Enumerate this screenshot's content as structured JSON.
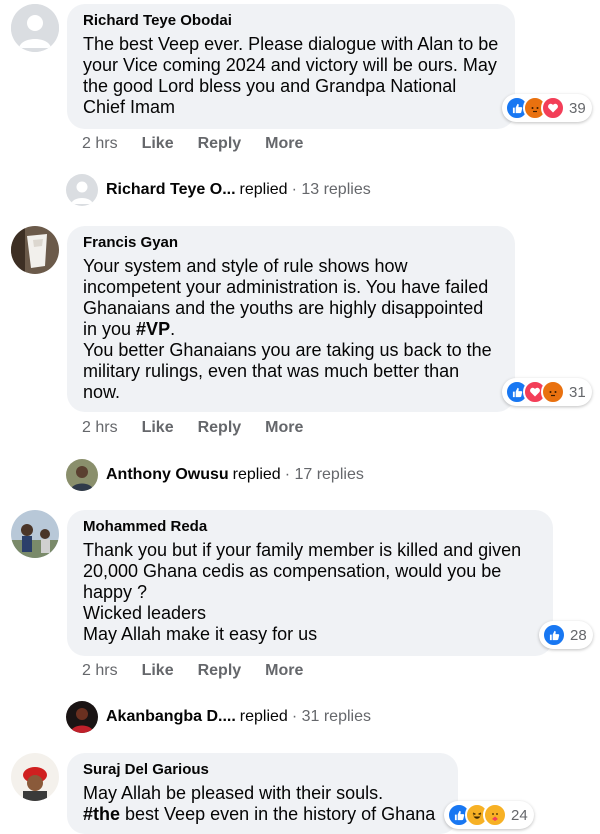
{
  "comments": [
    {
      "author": "Richard Teye Obodai",
      "text": "The best Veep ever. Please dialogue with Alan to be your Vice coming 2024 and victory will be ours. May the good Lord bless you and Grandpa National Chief Imam",
      "reactions": [
        "like-icon",
        "angry-icon",
        "love-icon"
      ],
      "reaction_count": "39",
      "time": "2 hrs",
      "like": "Like",
      "reply": "Reply",
      "more": "More",
      "replies": {
        "name": "Richard Teye O...",
        "verb": "replied",
        "count": "· 13 replies"
      }
    },
    {
      "author": "Francis Gyan",
      "text_before": "Your system and style of rule shows how incompetent your administration is. You have failed Ghanaians and the youths are highly disappointed in you ",
      "hashtag": "#VP",
      "text_after": ".\nYou better Ghanaians you are taking us back to the military rulings, even that was much better than now.",
      "reactions": [
        "like-icon",
        "love-icon",
        "angry-icon"
      ],
      "reaction_count": "31",
      "time": "2 hrs",
      "like": "Like",
      "reply": "Reply",
      "more": "More",
      "replies": {
        "name": "Anthony Owusu",
        "verb": "replied",
        "count": "· 17 replies"
      }
    },
    {
      "author": "Mohammed Reda",
      "text": "Thank you but if your family member is killed and given 20,000 Ghana cedis as compensation, would you be happy ?\nWicked leaders\nMay Allah make it easy for us",
      "reactions": [
        "like-icon"
      ],
      "reaction_count": "28",
      "time": "2 hrs",
      "like": "Like",
      "reply": "Reply",
      "more": "More",
      "replies": {
        "name": "Akanbangba D....",
        "verb": "replied",
        "count": "· 31 replies"
      }
    },
    {
      "author": "Suraj Del Garious",
      "line1": "May Allah be pleased with their souls.",
      "hashtag": "#the",
      "line2_rest": " best Veep even in the history of Ghana",
      "reactions": [
        "like-icon",
        "haha-icon",
        "care-icon"
      ],
      "reaction_count": "24"
    }
  ],
  "colors": {
    "like": "#1877f2",
    "love": "#f33e58",
    "angry": "#e9710f",
    "haha": "#f7b125"
  }
}
